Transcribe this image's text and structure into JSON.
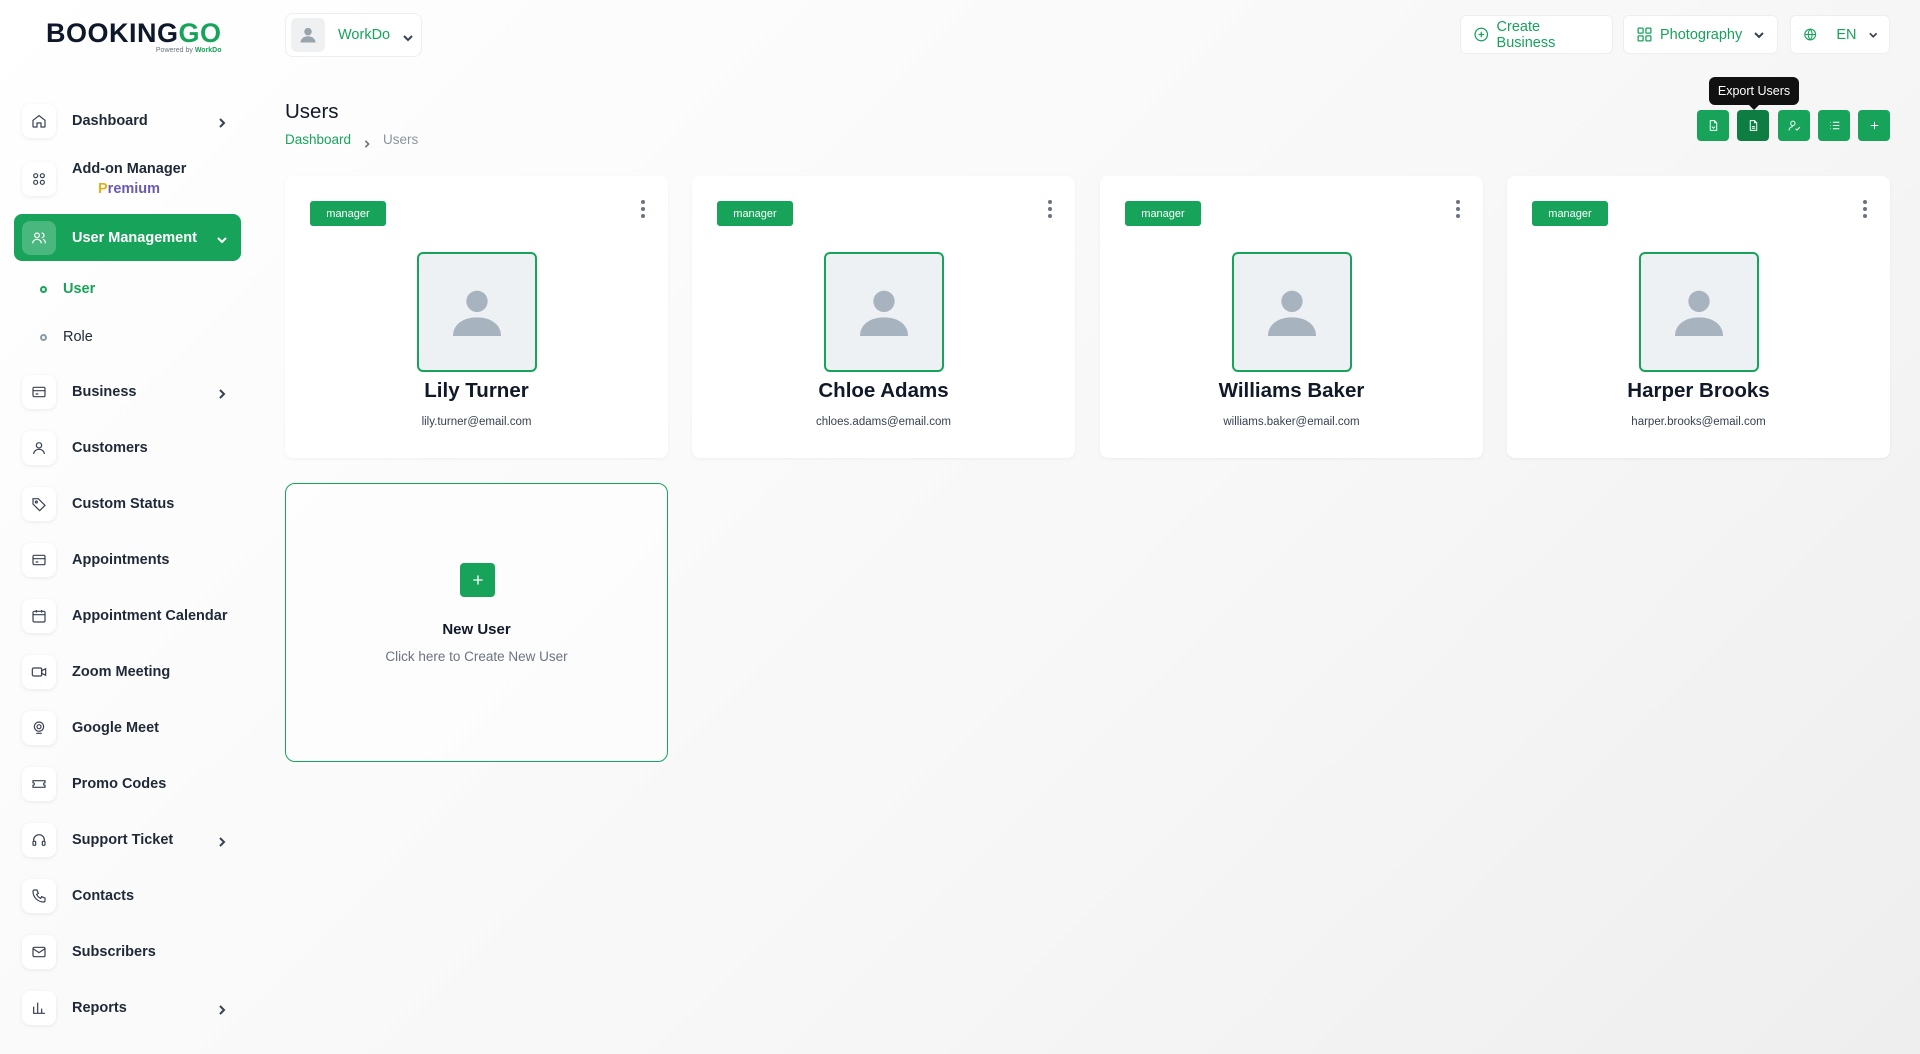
{
  "brand": {
    "main": "BOOKING",
    "accent": "GO",
    "powered": "Powered by",
    "powered_brand": "WorkDo"
  },
  "sidebar": {
    "dashboard": "Dashboard",
    "addon": "Add-on Manager",
    "premium_p": "P",
    "premium_rest": "remium",
    "user_management": "User Management",
    "sub_user": "User",
    "sub_role": "Role",
    "business": "Business",
    "customers": "Customers",
    "custom_status": "Custom Status",
    "appointments": "Appointments",
    "appointment_calendar": "Appointment Calendar",
    "zoom_meeting": "Zoom Meeting",
    "google_meet": "Google Meet",
    "promo_codes": "Promo Codes",
    "support_ticket": "Support Ticket",
    "contacts": "Contacts",
    "subscribers": "Subscribers",
    "reports": "Reports"
  },
  "topbar": {
    "workspace": "WorkDo",
    "create_business": "Create Business",
    "category": "Photography",
    "language": "EN"
  },
  "page": {
    "title": "Users",
    "breadcrumb_home": "Dashboard",
    "breadcrumb_current": "Users",
    "tooltip": "Export Users"
  },
  "users": [
    {
      "role": "manager",
      "name": "Lily Turner",
      "email": "lily.turner@email.com"
    },
    {
      "role": "manager",
      "name": "Chloe Adams",
      "email": "chloes.adams@email.com"
    },
    {
      "role": "manager",
      "name": "Williams Baker",
      "email": "williams.baker@email.com"
    },
    {
      "role": "manager",
      "name": "Harper Brooks",
      "email": "harper.brooks@email.com"
    }
  ],
  "new_user": {
    "title": "New User",
    "subtitle": "Click here to Create New User"
  },
  "colors": {
    "accent": "#17a35a",
    "accent_dark": "#0e7d42"
  }
}
